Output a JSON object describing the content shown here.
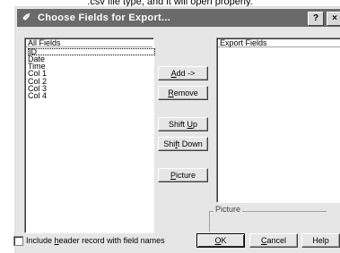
{
  "caption": ".csv file type, and it will open properly.",
  "window": {
    "icon": "brush-icon",
    "title": "Choose Fields for Export...",
    "help_glyph": "?",
    "close_glyph": "×"
  },
  "left_list": {
    "header": "All Fields",
    "items": [
      "ID",
      "Date",
      "Time",
      "Col 1",
      "Col 2",
      "Col 3",
      "Col 4"
    ]
  },
  "right_list": {
    "header": "Export Fields",
    "items": []
  },
  "buttons": {
    "add_pre": "",
    "add_key": "A",
    "add_post": "dd ->",
    "remove_pre": "",
    "remove_key": "R",
    "remove_post": "emove",
    "shiftup_pre": "Shift ",
    "shiftup_key": "U",
    "shiftup_post": "p",
    "shiftdown_pre": "Shi",
    "shiftdown_key": "f",
    "shiftdown_post": "t Down",
    "picture_pre": "",
    "picture_key": "P",
    "picture_post": "icture",
    "ok_pre": "",
    "ok_key": "O",
    "ok_post": "K",
    "cancel_pre": "",
    "cancel_key": "C",
    "cancel_post": "ancel",
    "help": "Help"
  },
  "picture_group": {
    "label": "Picture"
  },
  "header_option": {
    "pre": "Include ",
    "key": "h",
    "post": "eader record with field names",
    "checked": false
  }
}
